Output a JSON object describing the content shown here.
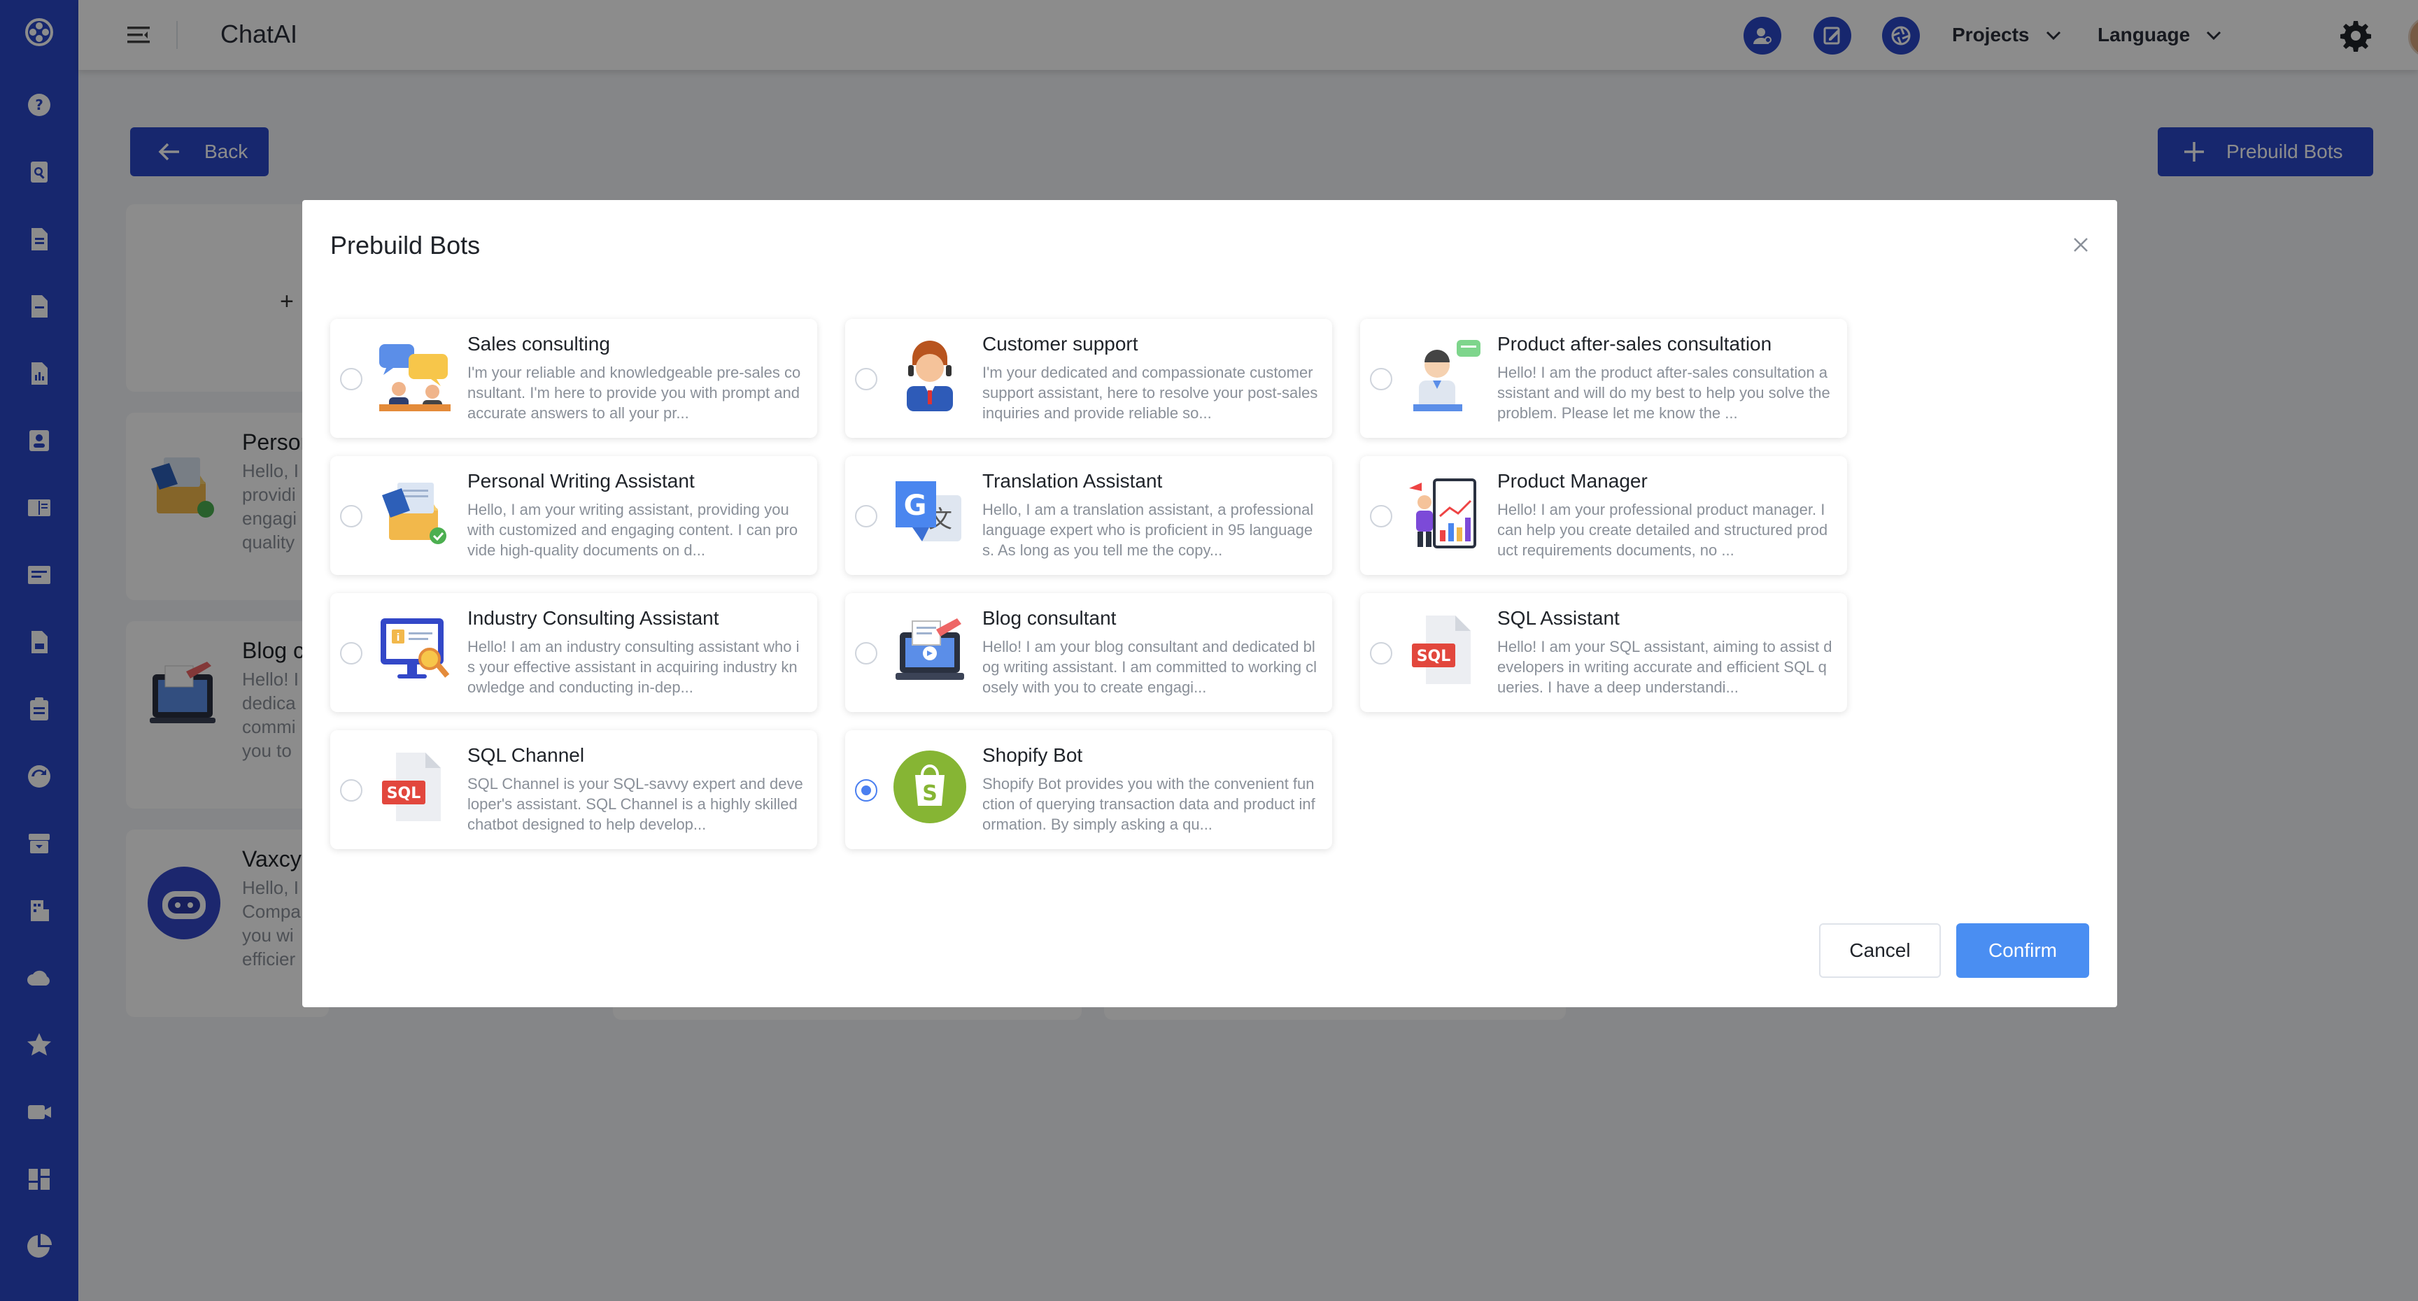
{
  "header": {
    "app_title": "ChatAI",
    "projects_label": "Projects",
    "language_label": "Language"
  },
  "page": {
    "back_label": "Back",
    "prebuild_label": "Prebuild Bots",
    "bg_cards": [
      {
        "title": "Persor",
        "lines": [
          "Hello, I",
          "providi",
          "engagi",
          "quality"
        ]
      },
      {
        "title": "Blog c",
        "lines": [
          "Hello! I",
          "dedica",
          "commi",
          "you to"
        ]
      },
      {
        "title": "Vaxcy",
        "lines": [
          "Hello, I",
          "Compa",
          "you wi",
          "efficier"
        ]
      }
    ]
  },
  "modal": {
    "title": "Prebuild Bots",
    "cancel_label": "Cancel",
    "confirm_label": "Confirm",
    "selected": "Shopify Bot",
    "bots": [
      {
        "name": "Sales consulting",
        "icon": "sales-consulting-icon",
        "desc": "I'm your reliable and knowledgeable pre-sales consultant. I'm here to provide you with prompt and accurate answers to all your pr..."
      },
      {
        "name": "Customer support",
        "icon": "customer-support-icon",
        "desc": "I'm your dedicated and compassionate customer support assistant, here to resolve your post-sales inquiries and provide reliable so..."
      },
      {
        "name": "Product after-sales consultation",
        "icon": "after-sales-icon",
        "desc": "Hello! I am the product after-sales consultation assistant and will do my best to help you solve the problem. Please let me know the ..."
      },
      {
        "name": "Personal Writing Assistant",
        "icon": "writing-assistant-icon",
        "desc": "Hello, I am your writing assistant, providing you with customized and engaging content. I can provide high-quality documents on d..."
      },
      {
        "name": "Translation Assistant",
        "icon": "translation-icon",
        "desc": "Hello, I am a translation assistant, a professional language expert who is proficient in 95 languages. As long as you tell me the copy..."
      },
      {
        "name": "Product Manager",
        "icon": "product-manager-icon",
        "desc": "Hello! I am your professional product manager. I can help you create detailed and structured product requirements documents, no ..."
      },
      {
        "name": "Industry Consulting Assistant",
        "icon": "industry-consulting-icon",
        "desc": "Hello! I am an industry consulting assistant who is your effective assistant in acquiring industry knowledge and conducting in-dep..."
      },
      {
        "name": "Blog consultant",
        "icon": "blog-consultant-icon",
        "desc": "Hello! I am your blog consultant and dedicated blog writing assistant. I am committed to working closely with you to create engagi..."
      },
      {
        "name": "SQL Assistant",
        "icon": "sql-file-icon",
        "desc": "Hello! I am your SQL assistant, aiming to assist developers in writing accurate and efficient SQL queries. I have a deep understandi..."
      },
      {
        "name": "SQL Channel",
        "icon": "sql-file-icon",
        "desc": "SQL Channel is your SQL-savvy expert and developer's assistant. SQL Channel is a highly skilled chatbot designed to help develop..."
      },
      {
        "name": "Shopify Bot",
        "icon": "shopify-icon",
        "desc": "Shopify Bot provides you with the convenient function of querying transaction data and product information. By simply asking a qu..."
      }
    ],
    "sql_badge": "SQL"
  }
}
